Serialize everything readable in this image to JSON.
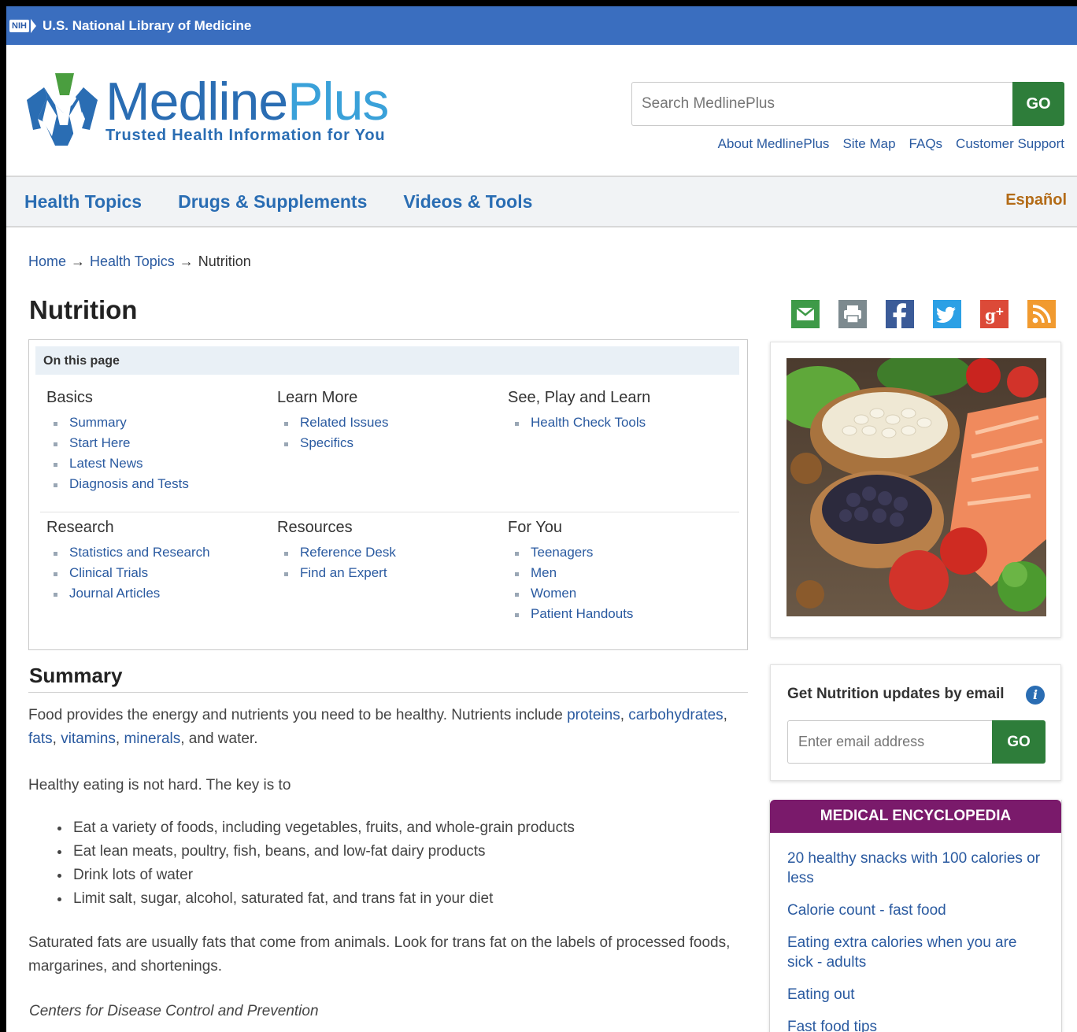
{
  "nih_bar": {
    "badge": "NIH",
    "label": "U.S. National Library of Medicine"
  },
  "logo": {
    "name_part1": "Medline",
    "name_part2": "Plus",
    "tagline": "Trusted Health Information for You"
  },
  "search": {
    "placeholder": "Search MedlinePlus",
    "button": "GO"
  },
  "utility_links": [
    "About MedlinePlus",
    "Site Map",
    "FAQs",
    "Customer Support"
  ],
  "main_nav": {
    "items": [
      "Health Topics",
      "Drugs & Supplements",
      "Videos & Tools"
    ],
    "language": "Español"
  },
  "breadcrumb": {
    "items": [
      "Home",
      "Health Topics"
    ],
    "current": "Nutrition",
    "separator": "→"
  },
  "page_title": "Nutrition",
  "on_this_page": {
    "heading": "On this page",
    "sections": [
      {
        "title": "Basics",
        "items": [
          "Summary",
          "Start Here",
          "Latest News",
          "Diagnosis and Tests"
        ]
      },
      {
        "title": "Learn More",
        "items": [
          "Related Issues",
          "Specifics"
        ]
      },
      {
        "title": "See, Play and Learn",
        "items": [
          "Health Check Tools"
        ]
      },
      {
        "title": "Research",
        "items": [
          "Statistics and Research",
          "Clinical Trials",
          "Journal Articles"
        ]
      },
      {
        "title": "Resources",
        "items": [
          "Reference Desk",
          "Find an Expert"
        ]
      },
      {
        "title": "For You",
        "items": [
          "Teenagers",
          "Men",
          "Women",
          "Patient Handouts"
        ]
      }
    ]
  },
  "summary": {
    "title": "Summary",
    "p1": {
      "pre": "Food provides the energy and nutrients you need to be healthy. Nutrients include ",
      "link1": "proteins",
      "c1": ", ",
      "link2": "carbohydrates",
      "c2": ", ",
      "link3": "fats",
      "c3": ", ",
      "link4": "vitamins",
      "c4": ", ",
      "link5": "minerals",
      "post": ", and water."
    },
    "p2": "Healthy eating is not hard. The key is to",
    "bullets": [
      "Eat a variety of foods, including vegetables, fruits, and whole-grain products",
      "Eat lean meats, poultry, fish, beans, and low-fat dairy products",
      "Drink lots of water",
      "Limit salt, sugar, alcohol, saturated fat, and trans fat in your diet"
    ],
    "p3": "Saturated fats are usually fats that come from animals. Look for trans fat on the labels of processed foods, margarines, and shortenings.",
    "source": "Centers for Disease Control and Prevention"
  },
  "share_icons": [
    "email-icon",
    "print-icon",
    "facebook-icon",
    "twitter-icon",
    "google-plus-icon",
    "rss-icon"
  ],
  "email_signup": {
    "title": "Get Nutrition updates by email",
    "info": "i",
    "placeholder": "Enter email address",
    "button": "GO"
  },
  "encyclopedia": {
    "title": "MEDICAL ENCYCLOPEDIA",
    "items": [
      "20 healthy snacks with 100 calories or less",
      "Calorie count - fast food",
      "Eating extra calories when you are sick - adults",
      "Eating out",
      "Fast food tips"
    ]
  },
  "colors": {
    "nih_blue": "#3a6ebf",
    "go_green": "#2e7d3a",
    "link_blue": "#2a5aa0",
    "espanol": "#b36b17",
    "encyclopedia": "#7a1a6b"
  }
}
